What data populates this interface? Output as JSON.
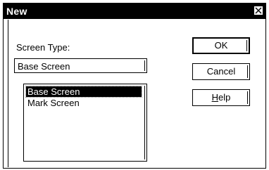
{
  "window": {
    "title": "New",
    "close_icon": "close-icon"
  },
  "form": {
    "screen_type_label": "Screen Type:",
    "screen_type_value": "Base Screen",
    "options": [
      "Base Screen",
      "Mark Screen"
    ],
    "selected_index": 0
  },
  "buttons": {
    "ok_label": "OK",
    "cancel_label": "Cancel",
    "help_label": "Help",
    "help_mnemonic": "H"
  }
}
